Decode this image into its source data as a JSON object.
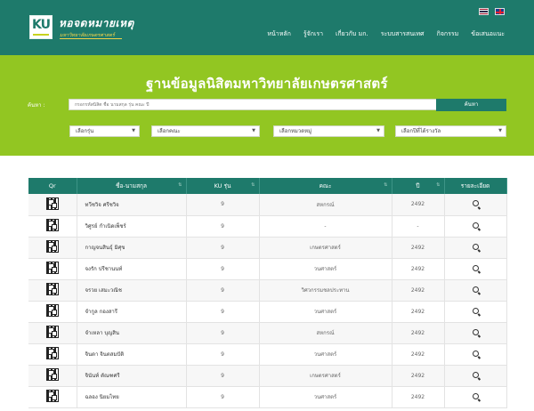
{
  "header": {
    "logo_text": "KU",
    "title": "หอจดหมายเหตุ",
    "subtitle": "มหาวิทยาลัยเกษตรศาสตร์",
    "nav": [
      "หน้าหลัก",
      "รู้จักเรา",
      "เกี่ยวกับ มก.",
      "ระบบสารสนเทศ",
      "กิจกรรม",
      "ข้อเสนอแนะ"
    ]
  },
  "hero": {
    "title": "ฐานข้อมูลนิสิตมหาวิทยาลัยเกษตรศาสตร์",
    "search_label": "ค้นหา :",
    "search_placeholder": "กรอกรหัสนิสิต ชื่อ นามสกุล รุ่น คณะ ปี",
    "search_button": "ค้นหา",
    "selects": [
      "เลือกรุ่น",
      "เลือกคณะ",
      "เลือกหมวดหมู่",
      "เลือกปีที่ได้รางวัล"
    ]
  },
  "table": {
    "columns": [
      "Qr",
      "ชื่อ-นามสกุล",
      "KU รุ่น",
      "คณะ",
      "ปี",
      "รายละเอียด"
    ],
    "rows": [
      {
        "name": "ทวีชวิจ ศรีชวิจ",
        "ku": "9",
        "faculty": "สหกรณ์",
        "year": "2492"
      },
      {
        "name": "วิศูรย์ กำเนิดเพ็ชร์",
        "ku": "9",
        "faculty": "-",
        "year": "-"
      },
      {
        "name": "กาญจนสินธุ์ มิศุข",
        "ku": "9",
        "faculty": "เกษตรศาสตร์",
        "year": "2492"
      },
      {
        "name": "จงรัก ปรีชานนท์",
        "ku": "9",
        "faculty": "วนศาสตร์",
        "year": "2492"
      },
      {
        "name": "จรวย เสมะวณิช",
        "ku": "9",
        "faculty": "วิศวกรรมชลประทาน",
        "year": "2492"
      },
      {
        "name": "จำกูล กองสารี",
        "ku": "9",
        "faculty": "วนศาสตร์",
        "year": "2492"
      },
      {
        "name": "จำเหลา บุญสิน",
        "ku": "9",
        "faculty": "สหกรณ์",
        "year": "2492"
      },
      {
        "name": "จินดา จินตสมปัติ",
        "ku": "9",
        "faculty": "วนศาสตร์",
        "year": "2492"
      },
      {
        "name": "จินันท์ ตัณฑศรี",
        "ku": "9",
        "faculty": "เกษตรศาสตร์",
        "year": "2492"
      },
      {
        "name": "ฉลอง นิยมไทย",
        "ku": "9",
        "faculty": "วนศาสตร์",
        "year": "2492"
      }
    ]
  },
  "colors": {
    "header_bg": "#1e7a6b",
    "hero_bg": "#92c622",
    "accent_yellow": "#f0d24a"
  }
}
